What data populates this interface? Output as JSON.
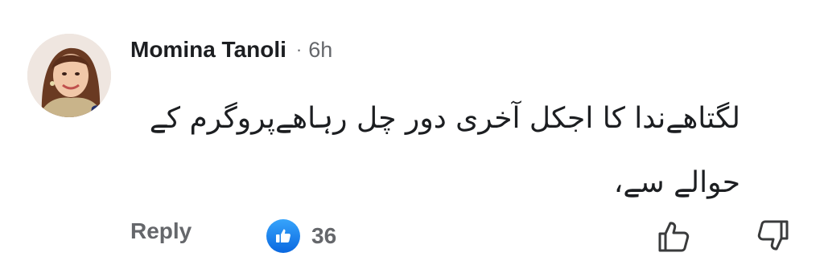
{
  "comment": {
    "author": "Momina Tanoli",
    "separator": "·",
    "time": "6h",
    "text": "لگتاھےندا کا اجکل آخری دور چل رہاھےپروگرم کے حوالے سے،",
    "reply_label": "Reply",
    "like_count": "36",
    "icons": {
      "avatar": "profile-photo",
      "reaction": "like-thumb-icon",
      "upvote": "thumbs-up-icon",
      "downvote": "thumbs-down-icon"
    },
    "colors": {
      "like_badge": "#1877f2",
      "muted_text": "#65676b",
      "primary_text": "#1c1e21"
    }
  }
}
